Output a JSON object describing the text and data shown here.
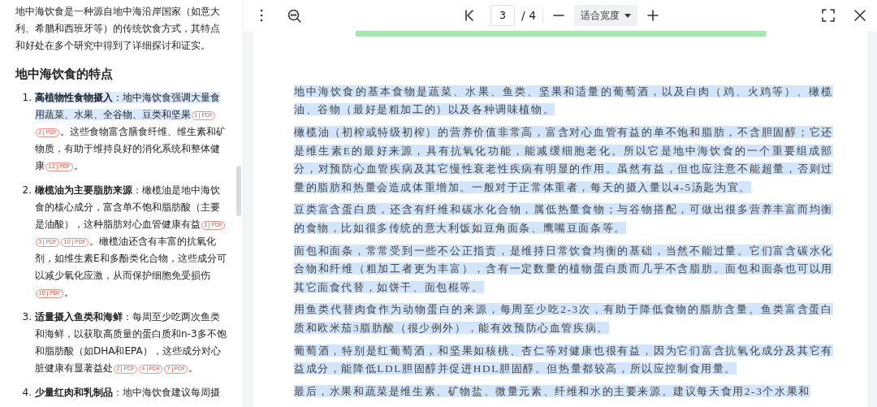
{
  "sidebar": {
    "intro": "地中海饮食是一种源自地中海沿岸国家（如意大利、希腊和西班牙等）的传统饮食方式，其特点和好处在多个研究中得到了详细探讨和证实。",
    "heading": "地中海饮食的特点",
    "items": [
      {
        "number": "1.",
        "title": "高植物性食物摄入",
        "title_highlighted": true,
        "segments": [
          {
            "kind": "text",
            "text": "：地中海饮食强调大量食用蔬菜、水果、全谷物、豆类和坚果",
            "highlighted": true
          },
          {
            "kind": "cite",
            "number": "1",
            "label": "PDF"
          },
          {
            "kind": "cite",
            "number": "2",
            "label": "PDF"
          },
          {
            "kind": "text",
            "text": "。这些食物富含膳食纤维、维生素和矿物质，有助于维持良好的消化系统和整体健康",
            "highlighted": false
          },
          {
            "kind": "cite",
            "number": "12",
            "label": "PDF"
          },
          {
            "kind": "text",
            "text": "。",
            "highlighted": false
          }
        ]
      },
      {
        "number": "2.",
        "title": "橄榄油为主要脂肪来源",
        "title_highlighted": false,
        "segments": [
          {
            "kind": "text",
            "text": "：橄榄油是地中海饮食的核心成分，富含单不饱和脂肪酸（主要是油酸），这种脂肪对心血管健康有益",
            "highlighted": false
          },
          {
            "kind": "cite",
            "number": "1",
            "label": "PDF"
          },
          {
            "kind": "cite",
            "number": "3",
            "label": "PDF"
          },
          {
            "kind": "cite",
            "number": "10",
            "label": "PDF"
          },
          {
            "kind": "text",
            "text": "。橄榄油还含有丰富的抗氧化剂，如维生素E和多酚类化合物，这些成分可以减少氧化应激，从而保护细胞免受损伤",
            "highlighted": false
          },
          {
            "kind": "cite",
            "number": "10",
            "label": "PDF"
          },
          {
            "kind": "text",
            "text": "。",
            "highlighted": false
          }
        ]
      },
      {
        "number": "3.",
        "title": "适量摄入鱼类和海鲜",
        "title_highlighted": false,
        "segments": [
          {
            "kind": "text",
            "text": "：每周至少吃两次鱼类和海鲜，以获取高质量的蛋白质和n-3多不饱和脂肪酸（如DHA和EPA），这些成分对心脏健康有显著益处",
            "highlighted": false
          },
          {
            "kind": "cite",
            "number": "2",
            "label": "PDF"
          },
          {
            "kind": "cite",
            "number": "4",
            "label": "PDF"
          },
          {
            "kind": "cite",
            "number": "7",
            "label": "PDF"
          },
          {
            "kind": "text",
            "text": "。",
            "highlighted": false
          }
        ]
      },
      {
        "number": "4.",
        "title": "少量红肉和乳制品",
        "title_highlighted": false,
        "segments": [
          {
            "kind": "text",
            "text": "：地中海饮食建议每周摄",
            "highlighted": false
          }
        ]
      }
    ]
  },
  "toolbar": {
    "page": "3",
    "total": "/ 4",
    "zoom": "适合宽度"
  },
  "document": {
    "paragraphs": [
      {
        "text": "地中海饮食的基本食物是蔬菜、水果、鱼类、坚果和适量的葡萄酒，以及白肉（鸡、火鸡等）、橄榄油、谷物（最好是粗加工的）以及各种调味植物。",
        "selected": true
      },
      {
        "text": "橄榄油（初榨或特级初榨）的营养价值非常高，富含对心血管有益的单不饱和脂肪，不含胆固醇；它还是维生素E的最好来源，具有抗氧化功能，能减缓细胞老化。所以它是地中海饮食的一个重要组成部分，对预防心血管疾病及其它慢性衰老性疾病有明显的作用。虽然有益，但也应注意不能超量，否则过量的脂肪和热量会造成体重增加。一般对于正常体重者，每天的摄入量以4-5汤匙为宜。",
        "selected": true
      },
      {
        "text": "豆类富含蛋白质，还含有纤维和碳水化合物，属低热量食物；与谷物搭配，可做出很多营养丰富而均衡的食物，比如很多传统的意大利饭如豆角面条、鹰嘴豆面条等。",
        "selected": true
      },
      {
        "text": "面包和面条，常常受到一些不公正指责，是维持日常饮食均衡的基础，当然不能过量。它们富含碳水化合物和纤维（粗加工者更为丰富），含有一定数量的植物蛋白质而几乎不含脂肪。面包和面条也可以用其它面食代替，如饼干、面包棍等。",
        "selected": true
      },
      {
        "text": "用鱼类代替肉食作为动物蛋白的来源，每周至少吃2-3次，有助于降低食物的脂肪含量。鱼类富含蛋白质和欧米茄3脂肪酸（很少例外），能有效预防心血管疾病。",
        "selected": true
      },
      {
        "text": "葡萄酒，特别是红葡萄酒，和坚果如核桃、杏仁等对健康也很有益，因为它们富含抗氧化成分及其它有益成分，能降低LDL胆固醇并促进HDL胆固醇。但热量都较高，所以应控制食用量。",
        "selected": true
      },
      {
        "text": "最后，水果和蔬菜是维生素、矿物盐、微量元素、纤维和水的主要来源。建议每天食用2-3个水果和",
        "selected": true
      }
    ]
  }
}
